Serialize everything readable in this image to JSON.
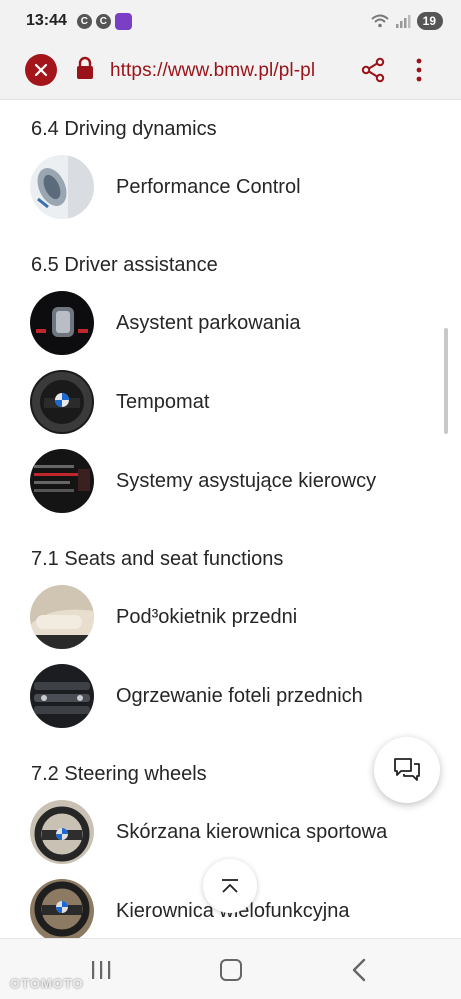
{
  "status_bar": {
    "time": "13:44",
    "notif_1": "C",
    "notif_2": "C",
    "battery": "19"
  },
  "browser": {
    "url": "https://www.bmw.pl/pl-pl",
    "accent_color": "#a3151a"
  },
  "sections": [
    {
      "title": "6.4 Driving dynamics",
      "items": [
        {
          "label": "Performance Control",
          "icon": "performance-control-thumbnail"
        }
      ]
    },
    {
      "title": "6.5 Driver assistance",
      "items": [
        {
          "label": "Asystent parkowania",
          "icon": "parking-assistant-thumbnail"
        },
        {
          "label": "Tempomat",
          "icon": "cruise-control-thumbnail"
        },
        {
          "label": "Systemy asystujące kierowcy",
          "icon": "driver-assist-systems-thumbnail"
        }
      ]
    },
    {
      "title": "7.1 Seats and seat functions",
      "items": [
        {
          "label": "Pod³okietnik przedni",
          "icon": "front-armrest-thumbnail"
        },
        {
          "label": "Ogrzewanie foteli przednich",
          "icon": "seat-heating-thumbnail"
        }
      ]
    },
    {
      "title": "7.2 Steering wheels",
      "items": [
        {
          "label": "Skórzana kierownica sportowa",
          "icon": "sport-steering-wheel-thumbnail"
        },
        {
          "label": "Kierownica wielofunkcyjna",
          "icon": "multifunction-steering-wheel-thumbnail"
        }
      ]
    }
  ],
  "watermark": "OTOMOTO"
}
